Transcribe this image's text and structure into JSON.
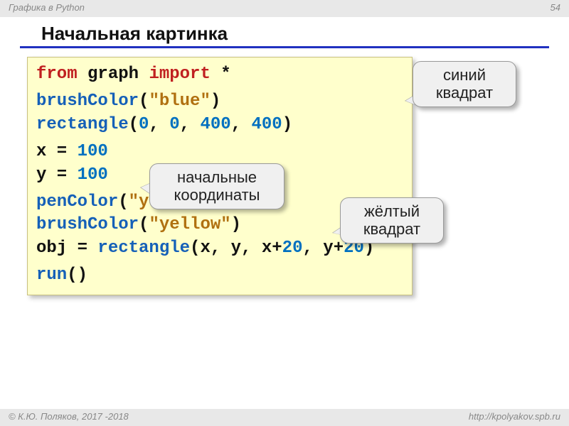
{
  "header": {
    "left": "Графика в Python",
    "page": "54"
  },
  "title": "Начальная картинка",
  "code": {
    "l1_from": "from",
    "l1_mod": " graph ",
    "l1_import": "import",
    "l1_star": " *",
    "l2_fn": "brushColor",
    "l2_open": "(",
    "l2_arg": "\"blue\"",
    "l2_close": ")",
    "l3_fn": "rectangle",
    "l3_open": "(",
    "l3_a": "0",
    "l3_c1": ", ",
    "l3_b": "0",
    "l3_c2": ", ",
    "l3_c": "400",
    "l3_c3": ", ",
    "l3_d": "400",
    "l3_close": ")",
    "l4_lhs": "x = ",
    "l4_val": "100",
    "l5_lhs": "y = ",
    "l5_val": "100",
    "l6_fn": "penColor",
    "l6_open": "(",
    "l6_arg": "\"yellow\"",
    "l6_close": ")",
    "l7_fn": "brushColor",
    "l7_open": "(",
    "l7_arg": "\"yellow\"",
    "l7_close": ")",
    "l8_lhs": "obj = ",
    "l8_fn": "rectangle",
    "l8_args1": "(x, y, x+",
    "l8_n1": "20",
    "l8_args2": ", y+",
    "l8_n2": "20",
    "l8_close": ")",
    "l9_fn": "run",
    "l9_par": "()"
  },
  "callouts": {
    "c1_l1": "синий",
    "c1_l2": "квадрат",
    "c2_l1": "начальные",
    "c2_l2": "координаты",
    "c3_l1": "жёлтый",
    "c3_l2": "квадрат"
  },
  "footer": {
    "left": "© К.Ю. Поляков, 2017 -2018",
    "right": "http://kpolyakov.spb.ru"
  }
}
